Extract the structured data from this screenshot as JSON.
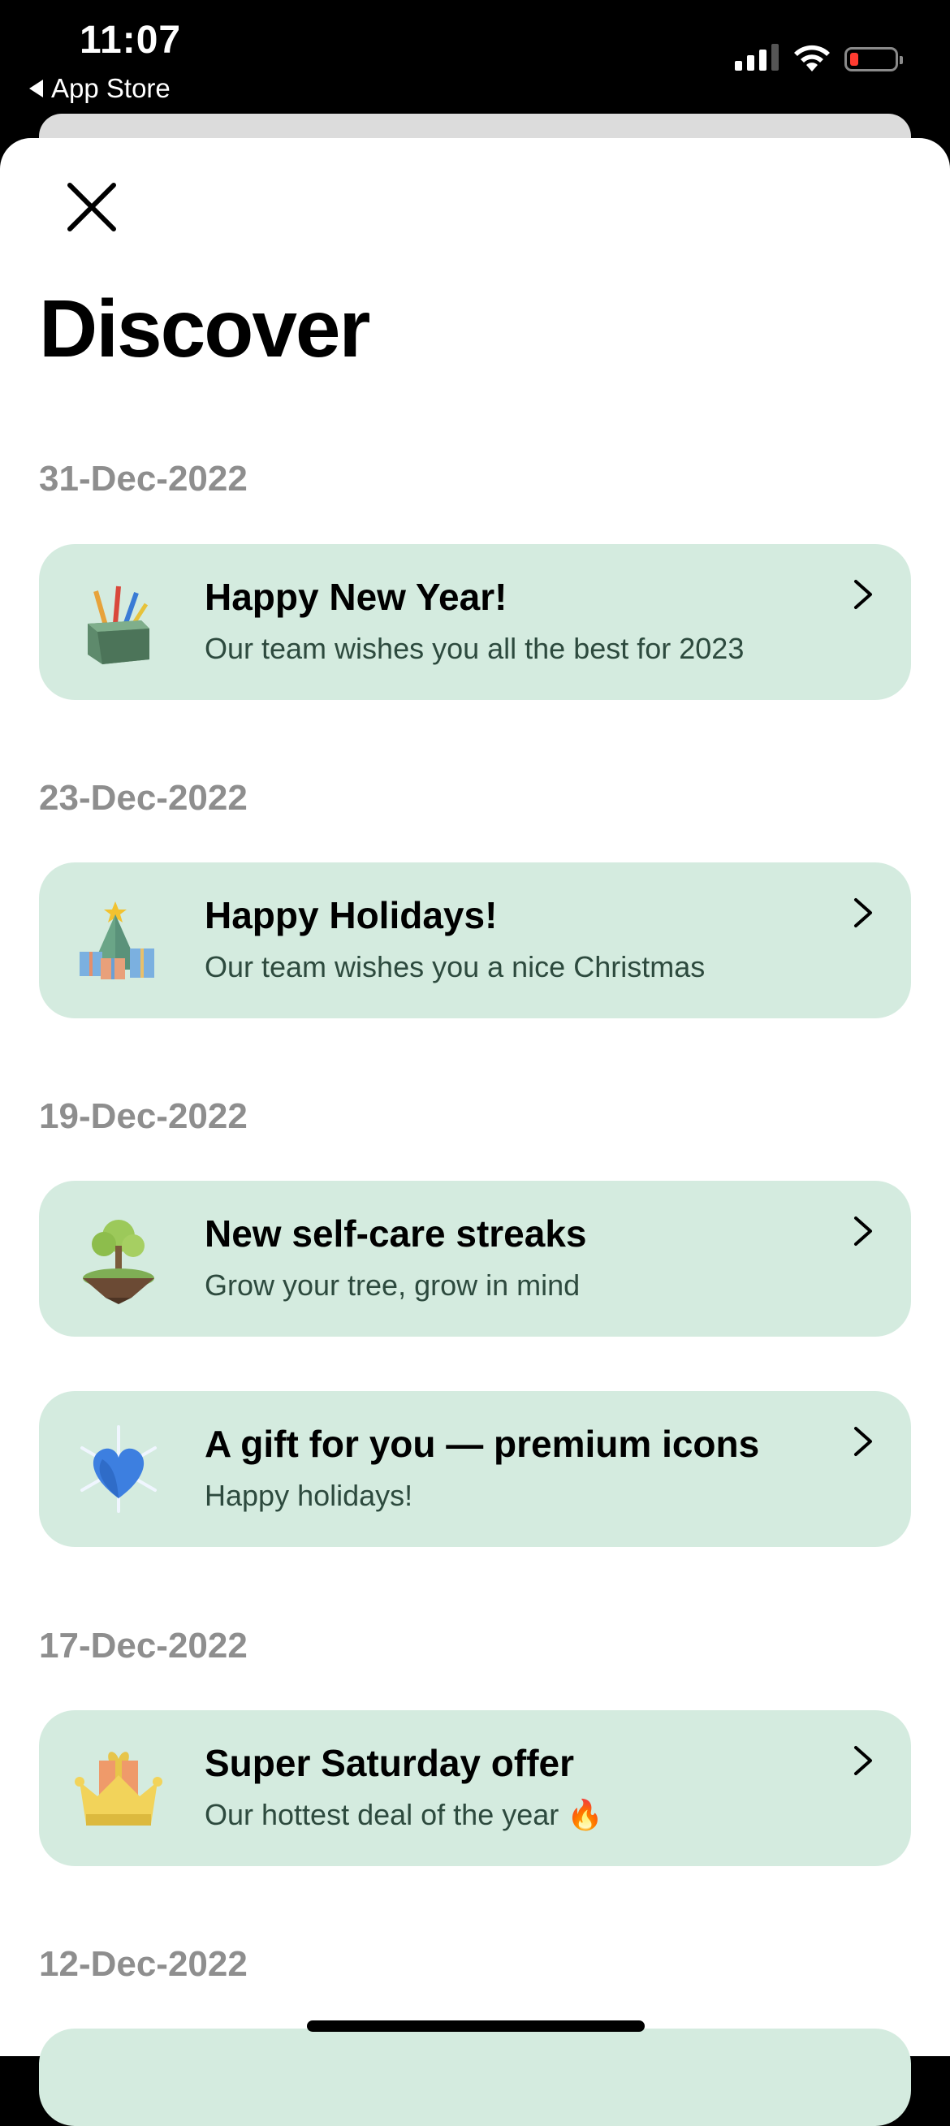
{
  "status_bar": {
    "time": "11:07",
    "back_label": "App Store",
    "battery_color": "#ff3b30"
  },
  "header": {
    "title": "Discover",
    "close_icon": "close-icon"
  },
  "sections": [
    {
      "date": "31-Dec-2022",
      "items": [
        {
          "title": "Happy New Year!",
          "subtitle": "Our team wishes you all the best for 2023",
          "icon": "fireworks-box-icon"
        }
      ]
    },
    {
      "date": "23-Dec-2022",
      "items": [
        {
          "title": "Happy Holidays!",
          "subtitle": "Our team wishes you a nice Christmas",
          "icon": "christmas-tree-gifts-icon"
        }
      ]
    },
    {
      "date": "19-Dec-2022",
      "items": [
        {
          "title": "New self-care streaks",
          "subtitle": "Grow your tree, grow in mind",
          "icon": "floating-tree-icon"
        },
        {
          "title": "A gift for you — premium icons",
          "subtitle": "Happy holidays!",
          "icon": "blue-heart-snowflake-icon"
        }
      ]
    },
    {
      "date": "17-Dec-2022",
      "items": [
        {
          "title": "Super Saturday offer",
          "subtitle": "Our hottest deal of the year 🔥",
          "icon": "crown-gift-icon"
        }
      ]
    },
    {
      "date": "12-Dec-2022",
      "items": []
    }
  ],
  "colors": {
    "card_background": "#d4ebdf",
    "date_label": "#8e8e8e",
    "subtitle_text": "#2d4a3e"
  }
}
